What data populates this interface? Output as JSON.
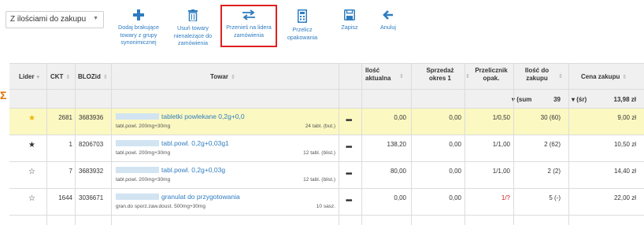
{
  "filter": {
    "selected": "Z ilościami do zakupu"
  },
  "toolbar": {
    "add_missing": "Dodaj brakujące towary z grupy synonimicznej",
    "remove_items": "Usuń towary nienależące do zamówienia",
    "move_leader": "Przenieś na lidera zamówienia",
    "recalc_packs": "Przelicz opakowania",
    "save": "Zapisz",
    "cancel": "Anuluj"
  },
  "columns": {
    "lider": "Lider",
    "ckt": "CKT",
    "blozid": "BLOZid",
    "towar": "Towar",
    "ilosc_aktualna": "Ilość aktualna",
    "sprzedaz": "Sprzedaż okres 1",
    "przelicznik": "Przelicznik opak.",
    "ilosc_zakup": "Ilość do zakupu",
    "cena_zakupu": "Cena zakupu"
  },
  "summary": {
    "qty_mode": "▾ (sum",
    "qty_value": "39",
    "price_mode": "▾ (śr)",
    "price_value": "13,98 zł"
  },
  "rows": [
    {
      "star": "★",
      "ckt": "2681",
      "bloz": "3683936",
      "name": "tabletki powlekane 0,2g+0,0",
      "sub": "tabl.powl. 200mg+30mg",
      "pack": "24 tabl. (but.)",
      "qty": "0,00",
      "sales": "0,00",
      "conv": "1/0,50",
      "buy": "30 (60)",
      "price": "9,00 zł"
    },
    {
      "star": "★",
      "ckt": "1",
      "bloz": "8206703",
      "name": "tabl.powl. 0,2g+0,03g1",
      "sub": "tabl.powl. 200mg+30mg",
      "pack": "12 tabl. (blist.)",
      "qty": "138,20",
      "sales": "0,00",
      "conv": "1/1,00",
      "buy": "2 (62)",
      "price": "10,50 zł"
    },
    {
      "star": "☆",
      "ckt": "7",
      "bloz": "3683932",
      "name": "tabl.powl. 0,2g+0,03g",
      "sub": "tabl.powl. 200mg+30mg",
      "pack": "12 tabl. (blist.)",
      "qty": "80,00",
      "sales": "0,00",
      "conv": "1/1,00",
      "buy": "2 (2)",
      "price": "14,40 zł"
    },
    {
      "star": "☆",
      "ckt": "1644",
      "bloz": "3036671",
      "name": "granulat do przygotowania",
      "sub": "gran.do sporz.zaw.doust. 500mg+30mg",
      "pack": "10 sasz.",
      "qty": "0,00",
      "sales": "0,00",
      "conv": "1/?",
      "buy": "5 (-)",
      "price": "22,00 zł"
    }
  ],
  "colors": {
    "accent": "#2e7cc0",
    "highlight_row": "#fbf8c2",
    "highlight_box": "#e02020",
    "star_gold": "#f0b400"
  }
}
